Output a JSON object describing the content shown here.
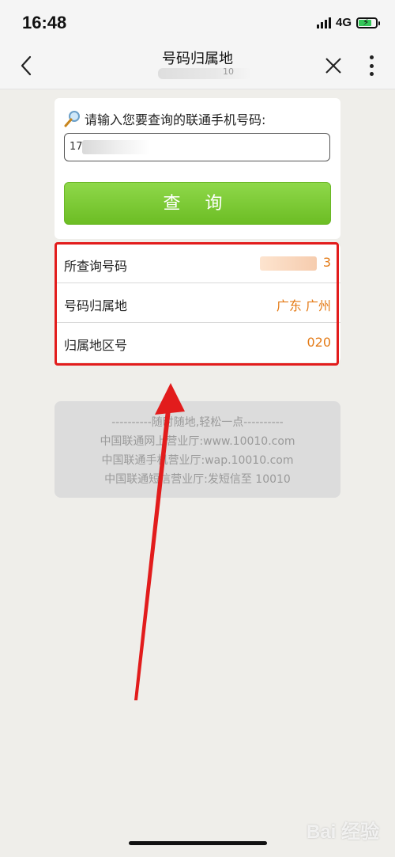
{
  "status": {
    "time": "16:48",
    "network": "4G"
  },
  "nav": {
    "title": "号码归属地",
    "subtitle_fragment": "10"
  },
  "query": {
    "prompt": "请输入您要查询的联通手机号码:",
    "input_fragment": "170",
    "button_label": "查 询"
  },
  "results": [
    {
      "label": "所查询号码",
      "value": "3"
    },
    {
      "label": "号码归属地",
      "value": "广东 广州"
    },
    {
      "label": "归属地区号",
      "value": "020"
    }
  ],
  "info": {
    "line1": "----------随时随地,轻松一点----------",
    "line2": "中国联通网上营业厅:www.10010.com",
    "line3": "中国联通手机营业厅:wap.10010.com",
    "line4": "中国联通短信营业厅:发短信至 10010"
  },
  "watermark": "Bai 经验",
  "colors": {
    "accent_orange": "#e47b17",
    "button_green": "#7bc934",
    "highlight_red": "#e21c1c"
  }
}
